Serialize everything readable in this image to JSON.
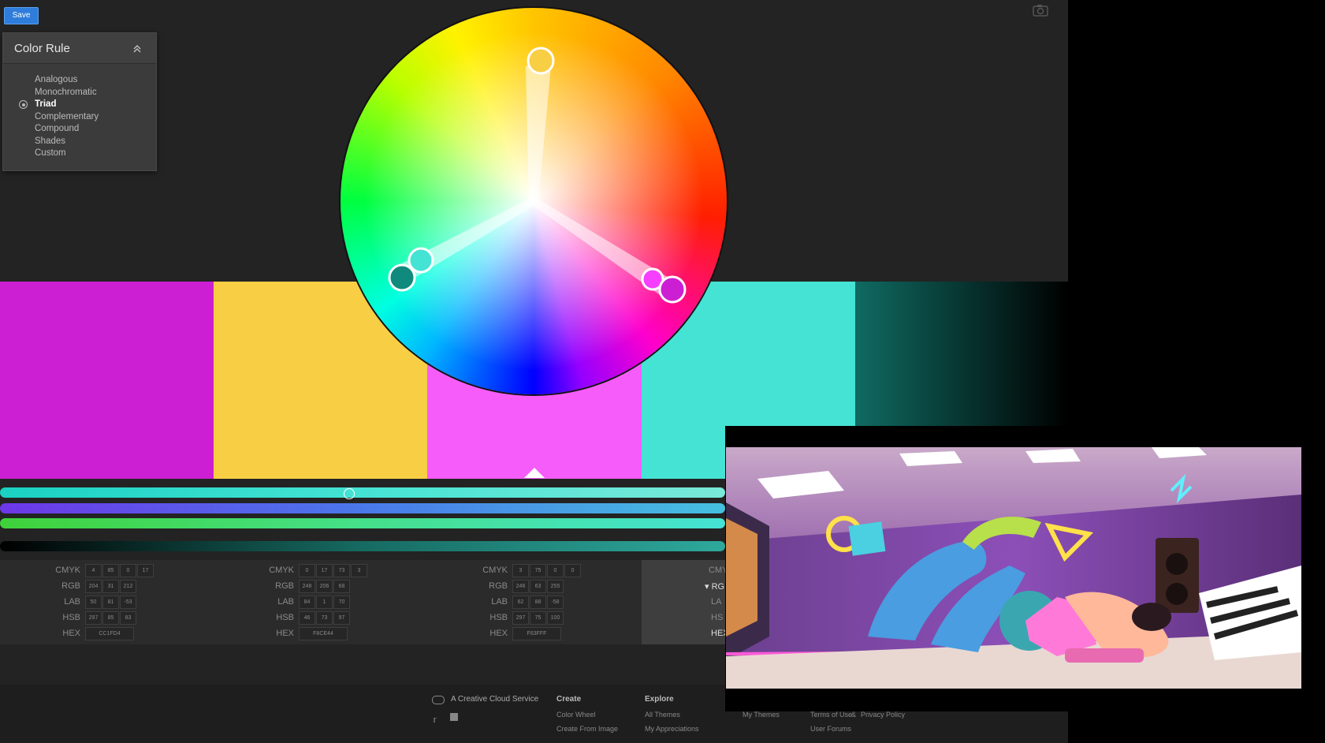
{
  "toolbar": {
    "save_label": "Save"
  },
  "color_rule": {
    "title": "Color Rule",
    "options": [
      "Analogous",
      "Monochromatic",
      "Triad",
      "Complementary",
      "Compound",
      "Shades",
      "Custom"
    ],
    "selected": "Triad"
  },
  "swatches": [
    {
      "hex": "#CC1FD4",
      "cmyk": [
        "4",
        "85",
        "0",
        "17"
      ],
      "rgb": [
        "204",
        "31",
        "212"
      ],
      "lab": [
        "50",
        "81",
        "-53"
      ],
      "hsb": [
        "297",
        "85",
        "83"
      ],
      "hex_label": "CC1FD4"
    },
    {
      "hex": "#F8CE44",
      "cmyk": [
        "0",
        "17",
        "73",
        "3"
      ],
      "rgb": [
        "248",
        "206",
        "68"
      ],
      "lab": [
        "84",
        "1",
        "70"
      ],
      "hsb": [
        "46",
        "73",
        "97"
      ],
      "hex_label": "F8CE44"
    },
    {
      "hex": "#F63FFF",
      "cmyk": [
        "3",
        "75",
        "0",
        "0"
      ],
      "rgb": [
        "246",
        "63",
        "255"
      ],
      "lab": [
        "62",
        "88",
        "-58"
      ],
      "hsb": [
        "297",
        "75",
        "100"
      ],
      "hex_label": "F63FFF"
    },
    {
      "hex": "#45E3D4",
      "cmyk": [],
      "rgb": [],
      "lab": [],
      "hsb": [],
      "hex_label": ""
    }
  ],
  "value_labels": {
    "cmyk": "CMYK",
    "rgb": "RGB",
    "lab": "LAB",
    "hsb": "HSB",
    "hex": "HEX",
    "rgb_partial": "RGB",
    "cmyk_partial": "CMY",
    "lab_partial": "LA",
    "hsb_partial": "HS",
    "hex_partial": "HEX"
  },
  "colors": {
    "app_bg": "#232323",
    "swatch5_gradient": [
      "#0f6b62",
      "#000000"
    ],
    "slider_hue": [
      "#1ad1c2",
      "#45e3d4",
      "#7ae9d9"
    ],
    "slider_sat": [
      "#6d37e8",
      "#4a78ea",
      "#45c0e0"
    ],
    "slider_bri": [
      "#3fd23a",
      "#45e08a",
      "#45e3d4"
    ],
    "slider_dark": [
      "#000000",
      "#166b62",
      "#2fa89c"
    ]
  },
  "footer": {
    "service": "A Creative Cloud Service",
    "create_head": "Create",
    "create_links": [
      "Color Wheel",
      "Create From Image"
    ],
    "explore_head": "Explore",
    "explore_links": [
      "All Themes",
      "My Appreciations"
    ],
    "my_themes": "My Themes",
    "terms": "Terms of Use",
    "amp": "&",
    "privacy": "Privacy Policy",
    "forums": "User Forums"
  },
  "icons": [
    "camera-icon",
    "collapse-icon",
    "radio-icon",
    "creative-cloud-icon",
    "twitter-icon",
    "facebook-icon"
  ]
}
